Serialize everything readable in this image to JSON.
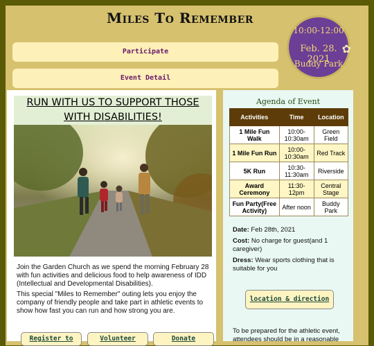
{
  "header": {
    "title": "Miles To Remember"
  },
  "nav": {
    "participate": "Participate",
    "event_detail": "Event Detail"
  },
  "badge": {
    "time": "10:00-12:00",
    "date": "Feb. 28. 2021",
    "place": "Buddy Park"
  },
  "main": {
    "headline": "RUN WITH US TO SUPPORT THOSE WITH DISABILITIES!",
    "para1": "Join the Garden Church as we spend the morning February 28 with fun activities and delicious food to help awareness of IDD (Intellectual and Developmental Disabilities).",
    "para2": "This special \"Miles to Remember\" outing lets you enjoy the company of friendly people and take part in athletic events to show how fast you can run and how strong you are.",
    "buttons": {
      "register": "Register to",
      "volunteer": "Volunteer",
      "donate": "Donate"
    }
  },
  "agenda": {
    "title": "Agenda of Event",
    "headers": [
      "Activities",
      "Time",
      "Location"
    ],
    "rows": [
      [
        "1 Mile Fun Walk",
        "10:00-10:30am",
        "Green Field"
      ],
      [
        "1 Mile Fun Run",
        "10:00-10:30am",
        "Red Track"
      ],
      [
        "5K Run",
        "10:30-11:30am",
        "Riverside"
      ],
      [
        "Award Ceremony",
        "11:30-12pm",
        "Central Stage"
      ],
      [
        "Fun Party(Free Activity)",
        "After noon",
        "Buddy Park"
      ]
    ]
  },
  "details": {
    "date_label": "Date:",
    "date_value": "Feb 28th, 2021",
    "cost_label": "Cost:",
    "cost_value": "No charge for guest(and 1 caregiver)",
    "dress_label": "Dress:",
    "dress_value": "Wear sports clothing that is suitable for you",
    "location_button": "location & direction",
    "prep_text": "To be prepared for the athletic event, attendees should be in a reasonable"
  }
}
